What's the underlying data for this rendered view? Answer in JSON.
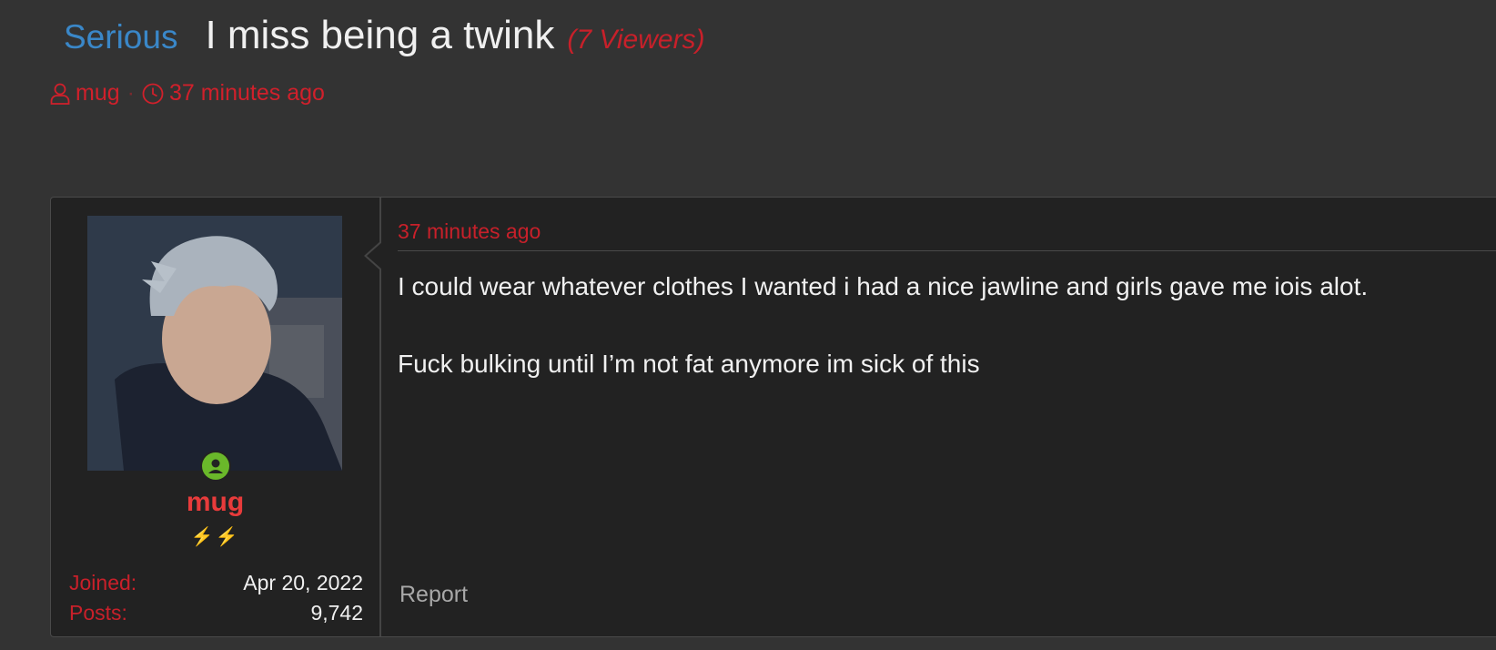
{
  "thread": {
    "prefix": "Serious",
    "title": "I miss being a twink",
    "viewers": "(7 Viewers)",
    "author": "mug",
    "time": "37 minutes ago"
  },
  "post": {
    "user": {
      "name": "mug",
      "badges": "⚡⚡",
      "joined_label": "Joined:",
      "joined_value": "Apr 20, 2022",
      "posts_label": "Posts:",
      "posts_value": "9,742"
    },
    "date": "37 minutes ago",
    "body": [
      "I could wear whatever clothes I wanted i had a nice jawline and girls gave me iois alot.",
      "Fuck bulking until I’m not fat anymore im sick of this"
    ],
    "report_label": "Report"
  },
  "icons": {
    "user": "user-icon",
    "clock": "clock-icon",
    "online": "online-status-icon"
  },
  "colors": {
    "background": "#333333",
    "panel": "#222222",
    "accent_red": "#c8202a",
    "username_red": "#e83b3b",
    "prefix_blue": "#3a87c8",
    "online_green": "#6ab82a"
  }
}
